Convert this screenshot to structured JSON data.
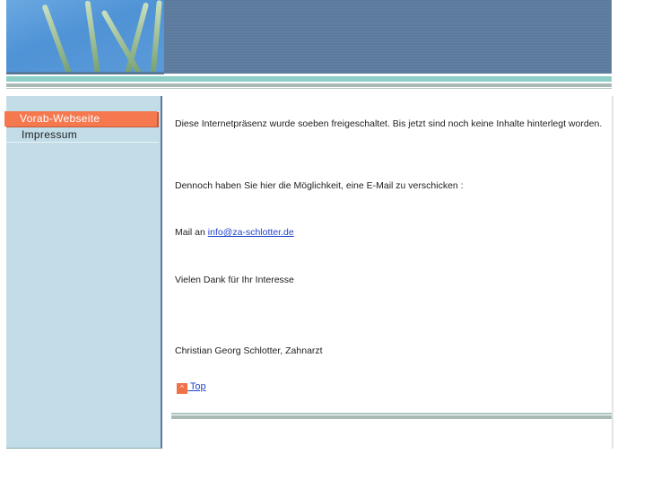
{
  "nav": {
    "items": [
      {
        "label": "Vorab-Webseite",
        "active": true
      },
      {
        "label": "Impressum",
        "active": false
      }
    ]
  },
  "content": {
    "p1": "Diese Internetpräsenz wurde soeben freigeschaltet. Bis jetzt sind noch keine Inhalte hinterlegt worden.",
    "p2": "Dennoch haben Sie hier die Möglichkeit, eine E-Mail zu verschicken :",
    "mail_prefix": "Mail an",
    "mail_link": "info@za-schlotter.de",
    "p4": "Vielen Dank für Ihr Interesse",
    "p5": "Christian Georg Schlotter, Zahnarzt",
    "top_label": "Top",
    "top_icon": "arrow-up-icon"
  },
  "colors": {
    "header": "#5b7a9d",
    "sidebar": "#c2dde8",
    "active": "#f5784f",
    "teal": "#8ecfc8"
  }
}
